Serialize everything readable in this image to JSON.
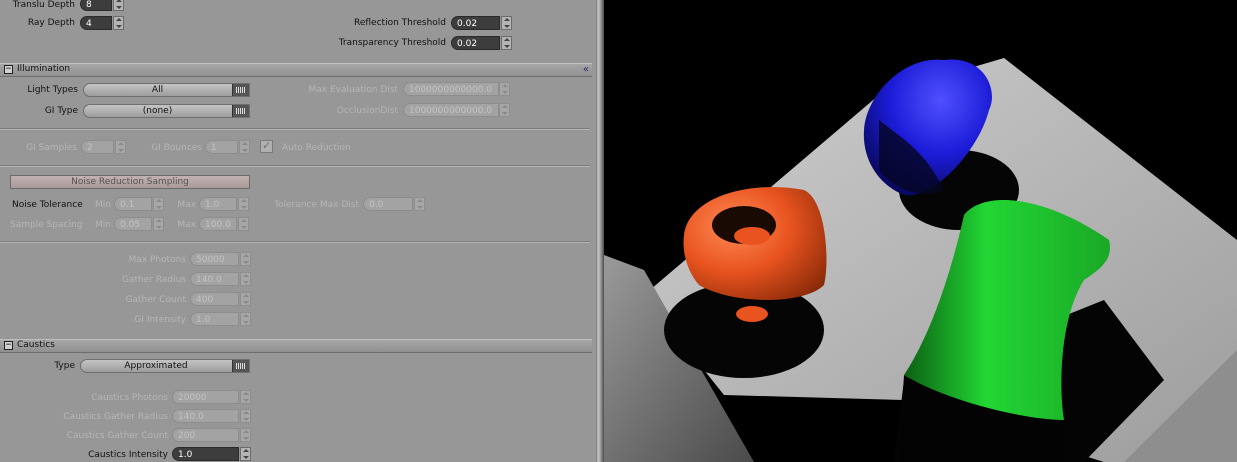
{
  "render": {
    "translu_depth": {
      "label": "Translu Depth",
      "value": "8"
    },
    "ray_depth": {
      "label": "Ray Depth",
      "value": "4"
    },
    "reflection_threshold": {
      "label": "Reflection Threshold",
      "value": "0.02"
    },
    "transparency_threshold": {
      "label": "Transparency Threshold",
      "value": "0.02"
    }
  },
  "illumination": {
    "title": "Illumination",
    "light_types": {
      "label": "Light Types",
      "value": "All"
    },
    "gi_type": {
      "label": "GI Type",
      "value": "(none)"
    },
    "max_eval_dist": {
      "label": "Max Evaluation Dist",
      "value": "1000000000000.0"
    },
    "occlusion_dist": {
      "label": "OcclusionDist",
      "value": "1000000000000.0"
    },
    "gi_samples": {
      "label": "GI Samples",
      "value": "2"
    },
    "gi_bounces": {
      "label": "GI Bounces",
      "value": "1"
    },
    "auto_reduction": {
      "label": "Auto Reduction"
    },
    "noise_button": "Noise Reduction Sampling",
    "noise_tolerance": {
      "label": "Noise Tolerance",
      "min_label": "Min",
      "min": "0.1",
      "max_label": "Max",
      "max": "1.0"
    },
    "tolerance_max_dist": {
      "label": "Tolerance Max Dist",
      "value": "0.0"
    },
    "sample_spacing": {
      "label": "Sample Spacing",
      "min_label": "Min",
      "min": "0.05",
      "max_label": "Max",
      "max": "100.0"
    },
    "max_photons": {
      "label": "Max Photons",
      "value": "50000"
    },
    "gather_radius": {
      "label": "Gather Radius",
      "value": "140.0"
    },
    "gather_count": {
      "label": "Gather Count",
      "value": "400"
    },
    "gi_intensity": {
      "label": "GI Intensity",
      "value": "1.0"
    }
  },
  "caustics": {
    "title": "Caustics",
    "type": {
      "label": "Type",
      "value": "Approximated"
    },
    "photons": {
      "label": "Caustics Photons",
      "value": "20000"
    },
    "gather_radius": {
      "label": "Caustics Gather Radius",
      "value": "140.0"
    },
    "gather_count": {
      "label": "Caustics Gather Count",
      "value": "200"
    },
    "intensity": {
      "label": "Caustics Intensity",
      "value": "1.0"
    }
  },
  "colors": {
    "orange_object": "#e8531f",
    "blue_object": "#1c1cd8",
    "green_object": "#22d634",
    "floor": "#b7b7b7"
  }
}
